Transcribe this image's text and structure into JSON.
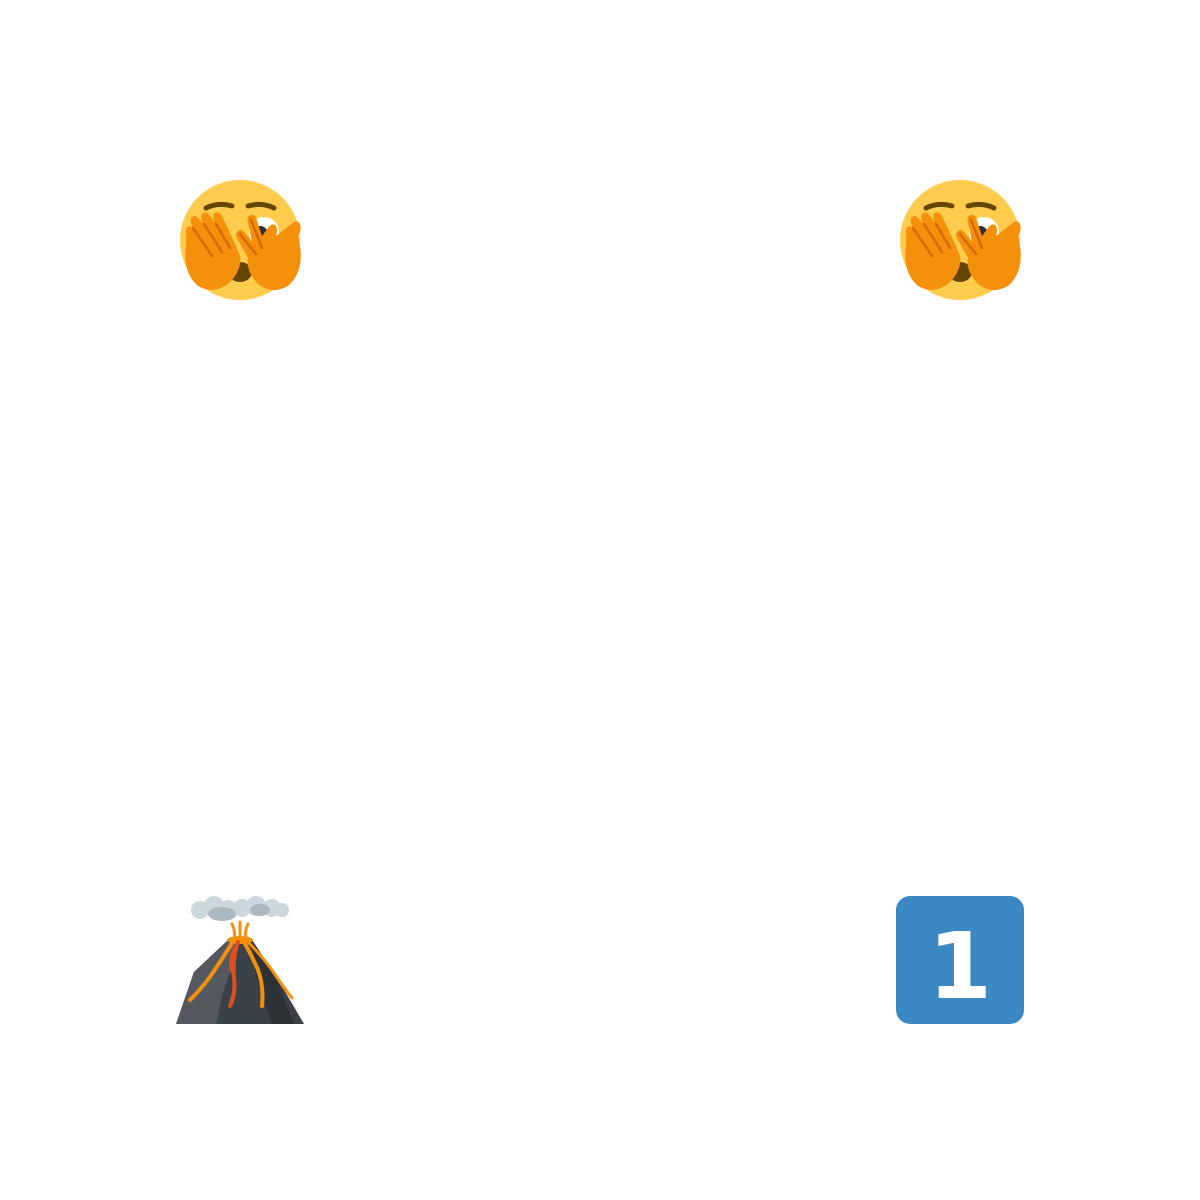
{
  "emojis": [
    {
      "icon": "face-with-peeking-eye-icon",
      "position": "top-left"
    },
    {
      "icon": "face-with-peeking-eye-icon",
      "position": "top-right"
    },
    {
      "icon": "volcano-icon",
      "position": "bottom-left"
    },
    {
      "icon": "keycap-digit-one-icon",
      "position": "bottom-right"
    }
  ],
  "keycap": {
    "digit": "1"
  },
  "colors": {
    "face": "#FFCC4D",
    "hand": "#F4900C",
    "hand_line": "#D66A00",
    "feature": "#664500",
    "eye_white": "#FFFFFF",
    "eye_pupil": "#292F33",
    "volcano_rock": "#3B4148",
    "volcano_rock_light": "#55595F",
    "lava_orange": "#F4900C",
    "lava_red": "#DD4F1E",
    "smoke": "#CCD6DD",
    "smoke_dark": "#AAB8C2",
    "keycap_bg": "#3B88C3",
    "keycap_digit": "#FFFFFF"
  }
}
